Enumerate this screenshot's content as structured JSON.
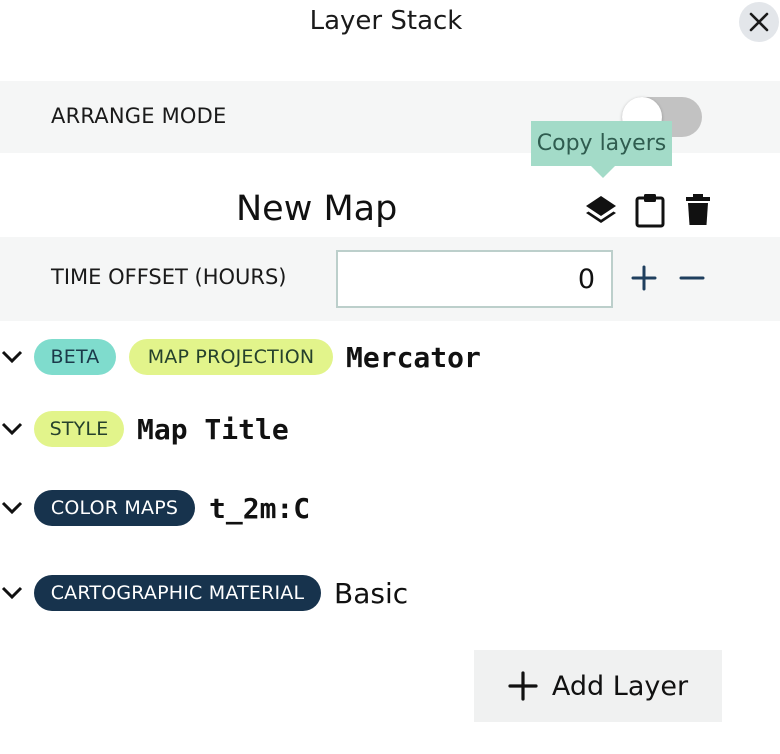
{
  "header": {
    "title": "Layer Stack",
    "close_icon": "close-icon"
  },
  "arrange": {
    "label": "ARRANGE MODE",
    "enabled": false
  },
  "tooltip": {
    "text": "Copy layers"
  },
  "map": {
    "title": "New Map",
    "tools": [
      "layers-icon",
      "clipboard-icon",
      "trash-icon"
    ]
  },
  "time_offset": {
    "label": "TIME OFFSET (HOURS)",
    "value": "0",
    "increment_icon": "plus-icon",
    "decrement_icon": "minus-icon"
  },
  "layers": [
    {
      "badges": [
        "BETA",
        "MAP PROJECTION"
      ],
      "value": "Mercator"
    },
    {
      "badges": [
        "STYLE"
      ],
      "value": "Map Title"
    },
    {
      "badges": [
        "COLOR MAPS"
      ],
      "value": "t_2m:C"
    },
    {
      "badges": [
        "CARTOGRAPHIC MATERIAL"
      ],
      "value": "Basic"
    }
  ],
  "add_layer": {
    "label": "Add Layer",
    "icon": "plus-icon"
  },
  "colors": {
    "teal": "#7fdccd",
    "lime": "#e2f48b",
    "navy": "#17334d",
    "tooltip": "#a3dbc8",
    "panel": "#f5f6f6"
  }
}
